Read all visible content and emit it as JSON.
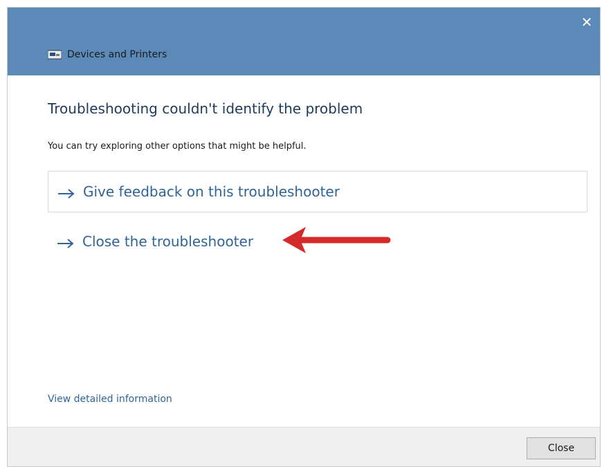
{
  "window": {
    "title": "Devices and Printers",
    "close_glyph": "✕",
    "icon": "devices-printers-icon"
  },
  "dialog": {
    "heading": "Troubleshooting couldn't identify the problem",
    "subtext": "You can try exploring other options that might be helpful.",
    "options": [
      {
        "label": "Give feedback on this troubleshooter",
        "icon": "arrow-right-icon"
      },
      {
        "label": "Close the troubleshooter",
        "icon": "arrow-right-icon"
      }
    ],
    "details_link": "View detailed information"
  },
  "footer": {
    "close_label": "Close"
  },
  "colors": {
    "titlebar": "#5b8ab8",
    "link": "#2f6499",
    "annotation_arrow": "#d42a2a"
  }
}
